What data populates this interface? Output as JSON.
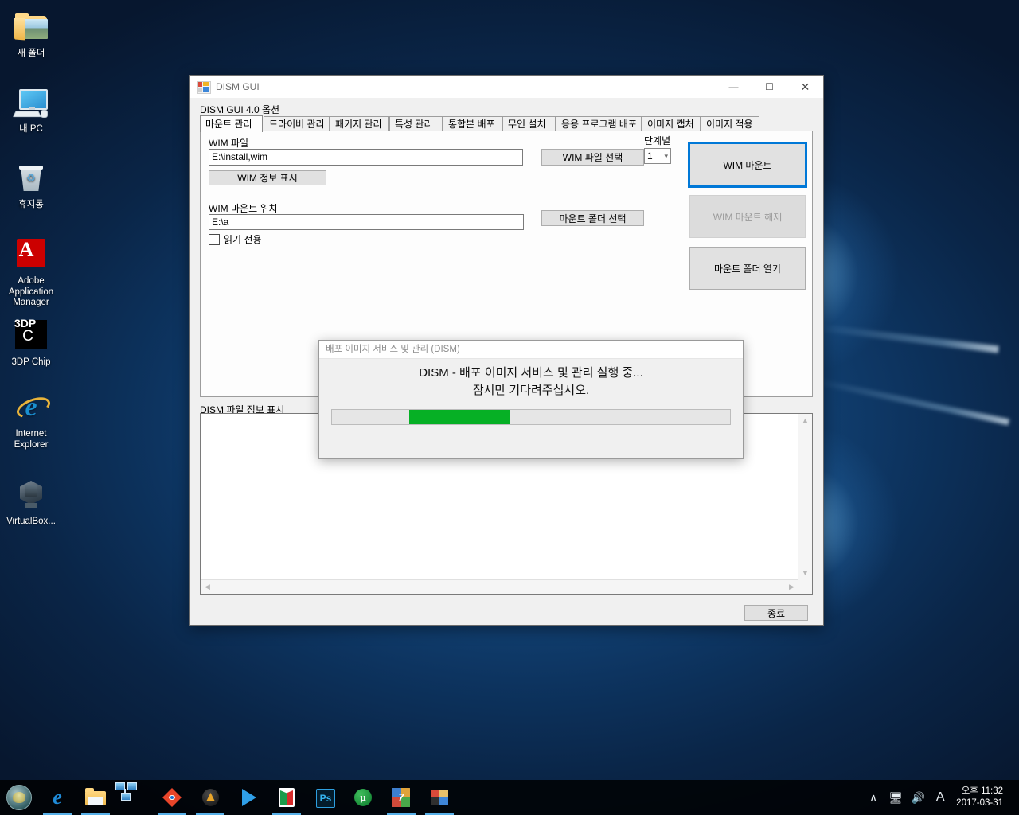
{
  "desktop": {
    "icons": [
      {
        "name": "new-folder",
        "label": "새 폴더"
      },
      {
        "name": "my-pc",
        "label": "내 PC"
      },
      {
        "name": "recycle-bin",
        "label": "휴지통"
      },
      {
        "name": "adobe-application-manager",
        "label": "Adobe Application Manager"
      },
      {
        "name": "3dp-chip",
        "label": "3DP Chip"
      },
      {
        "name": "internet-explorer",
        "label": "Internet Explorer"
      },
      {
        "name": "virtualbox",
        "label": "VirtualBox..."
      }
    ]
  },
  "taskbar": {
    "start_icon": "start-orb-icon",
    "items": [
      {
        "icon": "edge-icon",
        "active": true
      },
      {
        "icon": "file-explorer-icon",
        "active": true
      },
      {
        "icon": "network-tools-icon",
        "active": false
      },
      {
        "icon": "quicklook-icon",
        "active": true
      },
      {
        "icon": "amd-icon",
        "active": true
      },
      {
        "icon": "media-player-icon",
        "active": false
      },
      {
        "icon": "pdf-reader-icon",
        "active": true
      },
      {
        "icon": "photoshop-icon",
        "active": false
      },
      {
        "icon": "utorrent-icon",
        "active": false
      },
      {
        "icon": "7zip-icon",
        "active": true
      },
      {
        "icon": "color-app-icon",
        "active": true
      }
    ],
    "tray": {
      "chevron": "∧",
      "network_icon": "network-icon",
      "volume_icon": "volume-icon",
      "ime_indicator": "A",
      "time": "오후 11:32",
      "date": "2017-03-31"
    }
  },
  "window": {
    "title": "DISM GUI",
    "icon": "dism-gui-app-icon",
    "minimize": "—",
    "maximize": "☐",
    "close": "✕",
    "options_label": "DISM GUI 4.0 옵션",
    "tabs": [
      {
        "label": "마운트 관리",
        "active": true
      },
      {
        "label": "드라이버 관리",
        "active": false
      },
      {
        "label": "패키지 관리",
        "active": false
      },
      {
        "label": "특성 관리",
        "active": false
      },
      {
        "label": "통합본 배포",
        "active": false
      },
      {
        "label": "무인 설치",
        "active": false
      },
      {
        "label": "응용 프로그램 배포",
        "active": false
      },
      {
        "label": "이미지 캡처",
        "active": false
      },
      {
        "label": "이미지 적용",
        "active": false
      }
    ],
    "mount_tab": {
      "wim_file_label": "WIM 파일",
      "wim_file_value": "E:\\install,wim",
      "wim_file_select_button": "WIM 파일 선택",
      "wim_info_button": "WIM 정보 표시",
      "wim_mount_path_label": "WIM 마운트 위치",
      "wim_mount_path_value": "E:\\a",
      "mount_folder_select_button": "마운트 폴더 선택",
      "readonly_checkbox_label": "읽기 전용",
      "readonly_checked": false,
      "step_group_label": "단계별",
      "step_value": "1",
      "mount_button": "WIM 마운트",
      "unmount_button": "WIM 마운트 해제",
      "open_mount_folder_button": "마운트 폴더 열기"
    },
    "log_label": "DISM 파일 정보 표시",
    "log_value": "",
    "exit_button": "종료"
  },
  "dialog": {
    "title": "배포 이미지 서비스 및 관리 (DISM)",
    "message_line1": "DISM - 배포 이미지 서비스 및 관리 실행 중...",
    "message_line2": "잠시만 기다려주십시오.",
    "progress_style": "marquee",
    "progress_color": "#06b025"
  },
  "colors": {
    "accent": "#0078d7",
    "progress_green": "#06b025",
    "window_bg": "#f0f0f0",
    "taskbar_bg": "#000000"
  }
}
